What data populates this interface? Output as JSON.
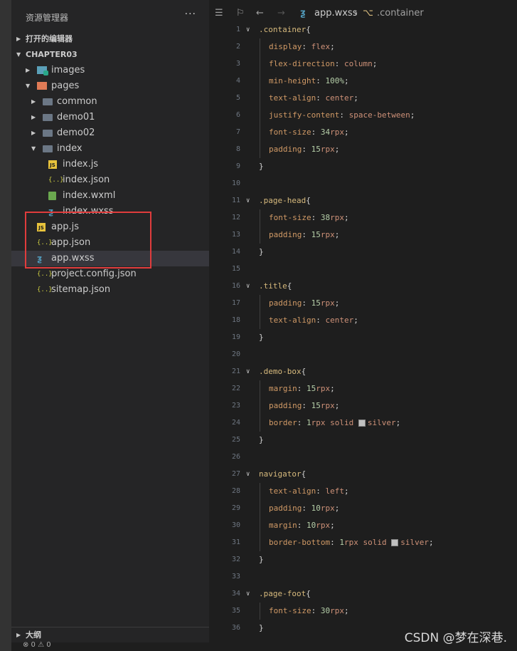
{
  "sidebar": {
    "title": "资源管理器",
    "more": "···",
    "open_editors": "打开的编辑器",
    "project": "CHAPTER03",
    "outline": "大纲",
    "status": "⊗ 0 ⚠ 0",
    "tree": [
      {
        "label": "images",
        "icon": "images-folder-icon",
        "kind": "folder-img",
        "indent": 1,
        "chev": "▶"
      },
      {
        "label": "pages",
        "icon": "pages-folder-icon",
        "kind": "folder-pages",
        "indent": 1,
        "chev": "▼"
      },
      {
        "label": "common",
        "icon": "folder-icon",
        "kind": "folder",
        "indent": 2,
        "chev": "▶"
      },
      {
        "label": "demo01",
        "icon": "folder-icon",
        "kind": "folder",
        "indent": 2,
        "chev": "▶"
      },
      {
        "label": "demo02",
        "icon": "folder-icon",
        "kind": "folder",
        "indent": 2,
        "chev": "▶"
      },
      {
        "label": "index",
        "icon": "folder-open-icon",
        "kind": "folder",
        "indent": 2,
        "chev": "▼"
      },
      {
        "label": "index.js",
        "icon": "js-file-icon",
        "kind": "js",
        "indent": 3,
        "chev": ""
      },
      {
        "label": "index.json",
        "icon": "json-file-icon",
        "kind": "json",
        "indent": 3,
        "chev": ""
      },
      {
        "label": "index.wxml",
        "icon": "wxml-file-icon",
        "kind": "wxml",
        "indent": 3,
        "chev": ""
      },
      {
        "label": "index.wxss",
        "icon": "wxss-file-icon",
        "kind": "wxss",
        "indent": 3,
        "chev": ""
      },
      {
        "label": "app.js",
        "icon": "js-file-icon",
        "kind": "js",
        "indent": 1,
        "chev": ""
      },
      {
        "label": "app.json",
        "icon": "json-file-icon",
        "kind": "json",
        "indent": 1,
        "chev": ""
      },
      {
        "label": "app.wxss",
        "icon": "wxss-file-icon",
        "kind": "wxss",
        "indent": 1,
        "chev": "",
        "selected": true
      },
      {
        "label": "project.config.json",
        "icon": "json-file-icon",
        "kind": "json",
        "indent": 1,
        "chev": ""
      },
      {
        "label": "sitemap.json",
        "icon": "json-file-icon",
        "kind": "json",
        "indent": 1,
        "chev": ""
      }
    ]
  },
  "editor": {
    "breadcrumb_file": "app.wxss",
    "breadcrumb_symbol": ".container",
    "lines": [
      {
        "n": "1",
        "fold": true,
        "tokens": [
          [
            "sel",
            ".container"
          ],
          [
            "punc",
            "{"
          ]
        ]
      },
      {
        "n": "2",
        "indent": true,
        "tokens": [
          [
            "prop",
            "display"
          ],
          [
            "punc",
            ": "
          ],
          [
            "val",
            "flex"
          ],
          [
            "punc",
            ";"
          ]
        ]
      },
      {
        "n": "3",
        "indent": true,
        "tokens": [
          [
            "prop",
            "flex-direction"
          ],
          [
            "punc",
            ": "
          ],
          [
            "val",
            "column"
          ],
          [
            "punc",
            ";"
          ]
        ]
      },
      {
        "n": "4",
        "indent": true,
        "tokens": [
          [
            "prop",
            "min-height"
          ],
          [
            "punc",
            ": "
          ],
          [
            "num",
            "100%"
          ],
          [
            "punc",
            ";"
          ]
        ]
      },
      {
        "n": "5",
        "indent": true,
        "tokens": [
          [
            "prop",
            "text-align"
          ],
          [
            "punc",
            ": "
          ],
          [
            "val",
            "center"
          ],
          [
            "punc",
            ";"
          ]
        ]
      },
      {
        "n": "6",
        "indent": true,
        "tokens": [
          [
            "prop",
            "justify-content"
          ],
          [
            "punc",
            ": "
          ],
          [
            "val",
            "space-between"
          ],
          [
            "punc",
            ";"
          ]
        ]
      },
      {
        "n": "7",
        "indent": true,
        "tokens": [
          [
            "prop",
            "font-size"
          ],
          [
            "punc",
            ": "
          ],
          [
            "num",
            "34"
          ],
          [
            "val",
            "rpx"
          ],
          [
            "punc",
            ";"
          ]
        ]
      },
      {
        "n": "8",
        "indent": true,
        "tokens": [
          [
            "prop",
            "padding"
          ],
          [
            "punc",
            ": "
          ],
          [
            "num",
            "15"
          ],
          [
            "val",
            "rpx"
          ],
          [
            "punc",
            ";"
          ]
        ]
      },
      {
        "n": "9",
        "tokens": [
          [
            "punc",
            "}"
          ]
        ]
      },
      {
        "n": "10",
        "tokens": []
      },
      {
        "n": "11",
        "fold": true,
        "tokens": [
          [
            "sel",
            ".page-head"
          ],
          [
            "punc",
            "{"
          ]
        ]
      },
      {
        "n": "12",
        "indent": true,
        "tokens": [
          [
            "prop",
            "font-size"
          ],
          [
            "punc",
            ": "
          ],
          [
            "num",
            "38"
          ],
          [
            "val",
            "rpx"
          ],
          [
            "punc",
            ";"
          ]
        ]
      },
      {
        "n": "13",
        "indent": true,
        "tokens": [
          [
            "prop",
            "padding"
          ],
          [
            "punc",
            ": "
          ],
          [
            "num",
            "15"
          ],
          [
            "val",
            "rpx"
          ],
          [
            "punc",
            ";"
          ]
        ]
      },
      {
        "n": "14",
        "tokens": [
          [
            "punc",
            "}"
          ]
        ]
      },
      {
        "n": "15",
        "tokens": []
      },
      {
        "n": "16",
        "fold": true,
        "tokens": [
          [
            "sel",
            ".title"
          ],
          [
            "punc",
            "{"
          ]
        ]
      },
      {
        "n": "17",
        "indent": true,
        "tokens": [
          [
            "prop",
            "padding"
          ],
          [
            "punc",
            ": "
          ],
          [
            "num",
            "15"
          ],
          [
            "val",
            "rpx"
          ],
          [
            "punc",
            ";"
          ]
        ]
      },
      {
        "n": "18",
        "indent": true,
        "tokens": [
          [
            "prop",
            "text-align"
          ],
          [
            "punc",
            ": "
          ],
          [
            "val",
            "center"
          ],
          [
            "punc",
            ";"
          ]
        ]
      },
      {
        "n": "19",
        "tokens": [
          [
            "punc",
            "}"
          ]
        ]
      },
      {
        "n": "20",
        "tokens": []
      },
      {
        "n": "21",
        "fold": true,
        "tokens": [
          [
            "sel",
            ".demo-box"
          ],
          [
            "punc",
            "{"
          ]
        ]
      },
      {
        "n": "22",
        "indent": true,
        "tokens": [
          [
            "prop",
            "margin"
          ],
          [
            "punc",
            ": "
          ],
          [
            "num",
            "15"
          ],
          [
            "val",
            "rpx"
          ],
          [
            "punc",
            ";"
          ]
        ]
      },
      {
        "n": "23",
        "indent": true,
        "tokens": [
          [
            "prop",
            "padding"
          ],
          [
            "punc",
            ": "
          ],
          [
            "num",
            "15"
          ],
          [
            "val",
            "rpx"
          ],
          [
            "punc",
            ";"
          ]
        ]
      },
      {
        "n": "24",
        "indent": true,
        "tokens": [
          [
            "prop",
            "border"
          ],
          [
            "punc",
            ": "
          ],
          [
            "num",
            "1"
          ],
          [
            "val",
            "rpx solid "
          ],
          [
            "swatch",
            ""
          ],
          [
            "val",
            "silver"
          ],
          [
            "punc",
            ";"
          ]
        ]
      },
      {
        "n": "25",
        "tokens": [
          [
            "punc",
            "}"
          ]
        ]
      },
      {
        "n": "26",
        "tokens": []
      },
      {
        "n": "27",
        "fold": true,
        "tokens": [
          [
            "sel",
            "navigator"
          ],
          [
            "punc",
            "{"
          ]
        ]
      },
      {
        "n": "28",
        "indent": true,
        "tokens": [
          [
            "prop",
            "text-align"
          ],
          [
            "punc",
            ": "
          ],
          [
            "val",
            "left"
          ],
          [
            "punc",
            ";"
          ]
        ]
      },
      {
        "n": "29",
        "indent": true,
        "tokens": [
          [
            "prop",
            "padding"
          ],
          [
            "punc",
            ": "
          ],
          [
            "num",
            "10"
          ],
          [
            "val",
            "rpx"
          ],
          [
            "punc",
            ";"
          ]
        ]
      },
      {
        "n": "30",
        "indent": true,
        "tokens": [
          [
            "prop",
            "margin"
          ],
          [
            "punc",
            ": "
          ],
          [
            "num",
            "10"
          ],
          [
            "val",
            "rpx"
          ],
          [
            "punc",
            ";"
          ]
        ]
      },
      {
        "n": "31",
        "indent": true,
        "tokens": [
          [
            "prop",
            "border-bottom"
          ],
          [
            "punc",
            ": "
          ],
          [
            "num",
            "1"
          ],
          [
            "val",
            "rpx solid "
          ],
          [
            "swatch",
            ""
          ],
          [
            "val",
            "silver"
          ],
          [
            "punc",
            ";"
          ]
        ]
      },
      {
        "n": "32",
        "tokens": [
          [
            "punc",
            "}"
          ]
        ]
      },
      {
        "n": "33",
        "tokens": []
      },
      {
        "n": "34",
        "fold": true,
        "tokens": [
          [
            "sel",
            ".page-foot"
          ],
          [
            "punc",
            "{"
          ]
        ]
      },
      {
        "n": "35",
        "indent": true,
        "tokens": [
          [
            "prop",
            "font-size"
          ],
          [
            "punc",
            ": "
          ],
          [
            "num",
            "30"
          ],
          [
            "val",
            "rpx"
          ],
          [
            "punc",
            ";"
          ]
        ]
      },
      {
        "n": "36",
        "tokens": [
          [
            "punc",
            "}"
          ]
        ]
      }
    ]
  },
  "watermark": "CSDN @梦在深巷.",
  "colors": {
    "selection": "#37373d",
    "highlight_box": "#e03c3c",
    "selector": "#d7ba7d",
    "property": "#d19a66"
  }
}
